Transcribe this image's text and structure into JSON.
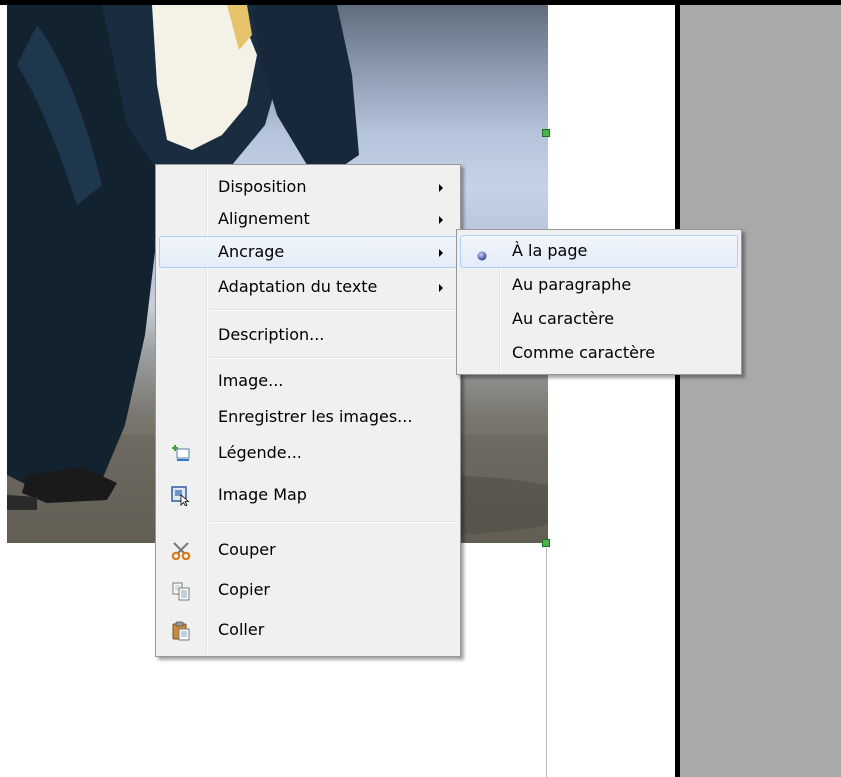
{
  "context_menu": {
    "items": [
      {
        "label": "Disposition",
        "submenu": true
      },
      {
        "label": "Alignement",
        "submenu": true
      },
      {
        "label": "Ancrage",
        "submenu": true,
        "highlighted": true
      },
      {
        "label": "Adaptation du texte",
        "submenu": true
      },
      {
        "label": "Description..."
      },
      {
        "label": "Image..."
      },
      {
        "label": "Enregistrer les images..."
      },
      {
        "label": "Légende...",
        "icon": "caption-icon"
      },
      {
        "label": "Image Map",
        "icon": "image-map-icon"
      },
      {
        "label": "Couper",
        "icon": "scissors-icon"
      },
      {
        "label": "Copier",
        "icon": "copy-icon"
      },
      {
        "label": "Coller",
        "icon": "paste-icon"
      }
    ]
  },
  "anchor_submenu": {
    "items": [
      {
        "label": "À la page",
        "selected": true
      },
      {
        "label": "Au paragraphe"
      },
      {
        "label": "Au caractère"
      },
      {
        "label": "Comme caractère"
      }
    ]
  },
  "colors": {
    "menu_bg": "#f0f0f0",
    "highlight_border": "#aecff7",
    "workspace_gray": "#a9a9a9",
    "handle_green": "#4bb34b"
  }
}
